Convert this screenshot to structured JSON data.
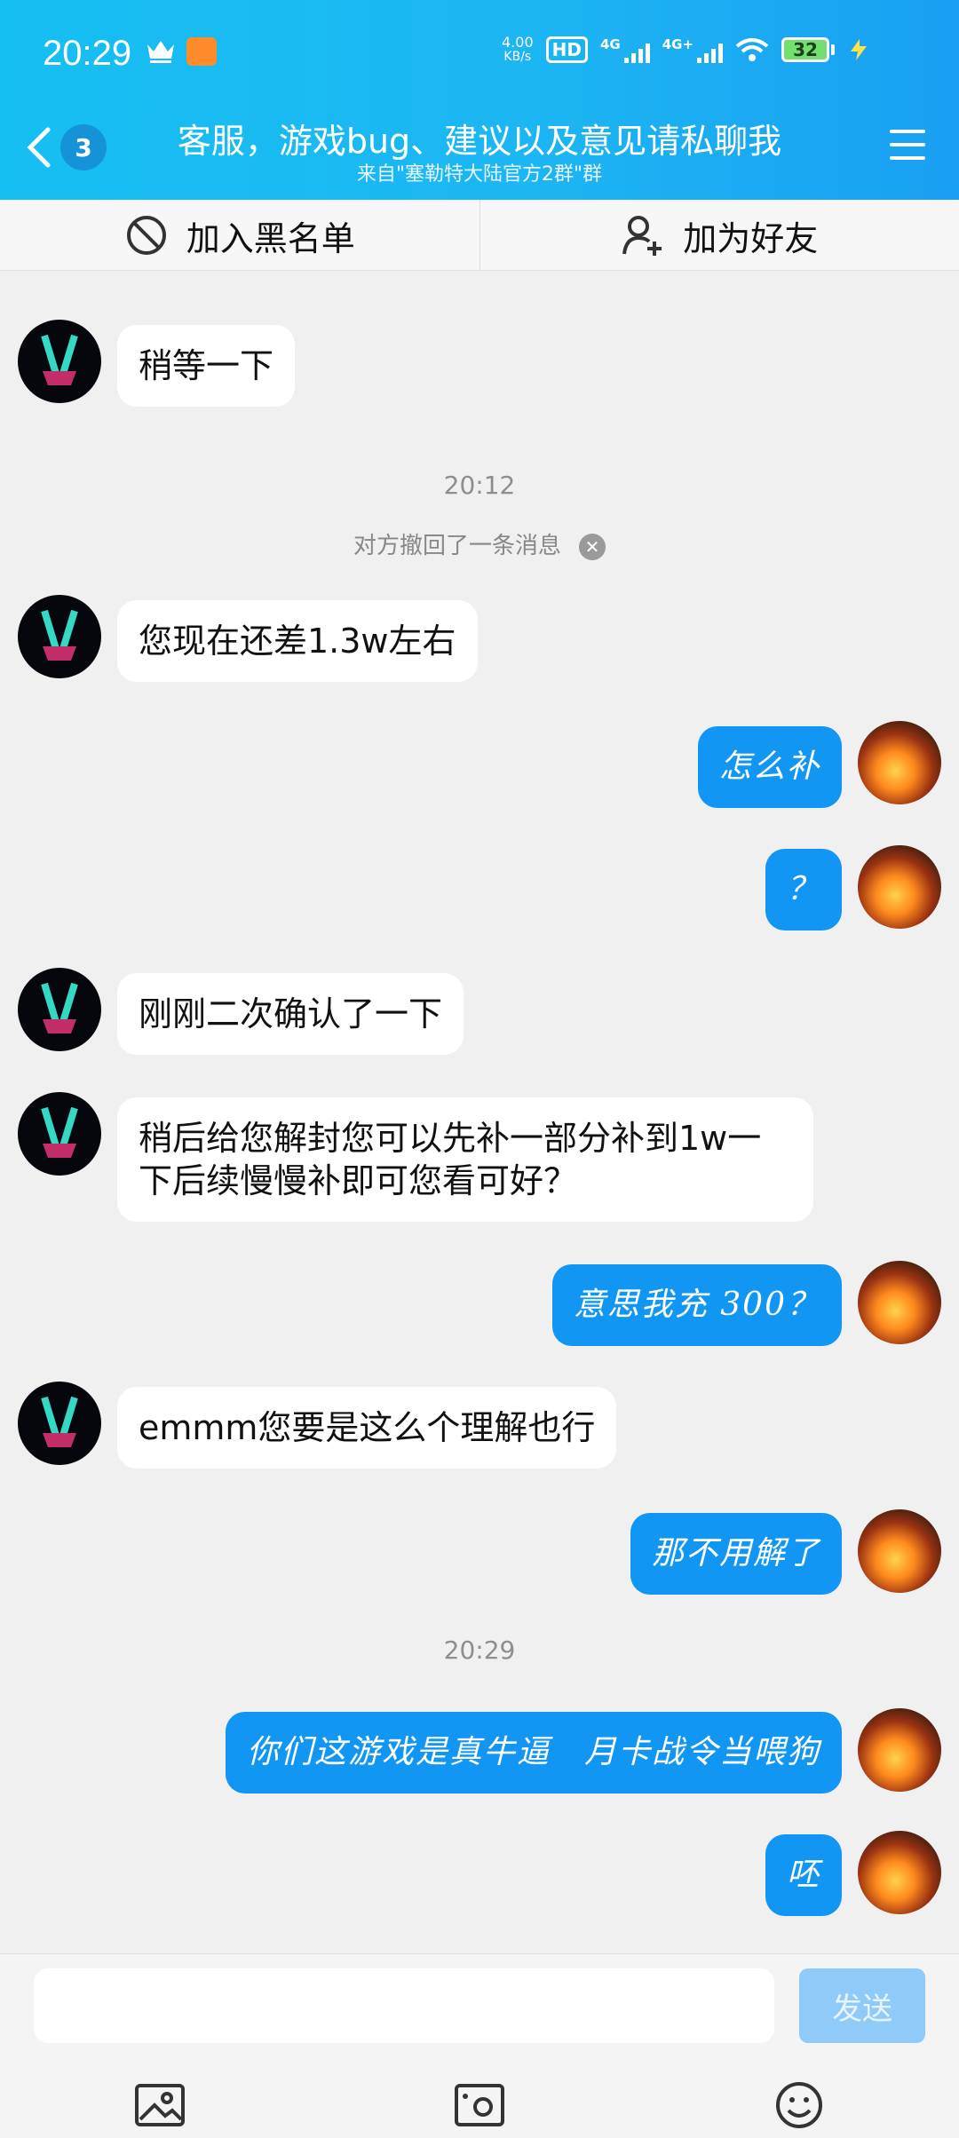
{
  "status_bar": {
    "time": "20:29",
    "net_speed_value": "4.00",
    "net_speed_unit": "KB/s",
    "hd_label": "HD",
    "signal_1": "4G",
    "signal_2": "4G+",
    "battery": "32"
  },
  "header": {
    "unread_count": "3",
    "title": "客服，游戏bug、建议以及意见请私聊我",
    "subtitle": "来自\"塞勒特大陆官方2群\"群"
  },
  "actions": {
    "blacklist": "加入黑名单",
    "add_friend": "加为好友"
  },
  "messages": [
    {
      "from": "other",
      "text": "稍等一下"
    },
    {
      "type": "time",
      "text": "20:12"
    },
    {
      "type": "recall",
      "text": "对方撤回了一条消息"
    },
    {
      "from": "other",
      "text": "您现在还差1.3w左右"
    },
    {
      "from": "me",
      "text": "怎么补"
    },
    {
      "from": "me",
      "text": "？"
    },
    {
      "from": "other",
      "text": "刚刚二次确认了一下"
    },
    {
      "from": "other",
      "text": "稍后给您解封您可以先补一部分补到1w一下后续慢慢补即可您看可好？"
    },
    {
      "from": "me",
      "text": "意思我充 300？"
    },
    {
      "from": "other",
      "text": "emmm您要是这么个理解也行"
    },
    {
      "from": "me",
      "text": "那不用解了"
    },
    {
      "type": "time",
      "text": "20:29"
    },
    {
      "from": "me",
      "text": "你们这游戏是真牛逼　月卡战令当喂狗"
    },
    {
      "from": "me",
      "text": "呸"
    }
  ],
  "composer": {
    "send_label": "发送",
    "placeholder": ""
  },
  "colors": {
    "header": "#17b6f3",
    "bubble_out": "#1296f3",
    "bubble_in": "#ffffff",
    "background": "#f0f0f0"
  }
}
